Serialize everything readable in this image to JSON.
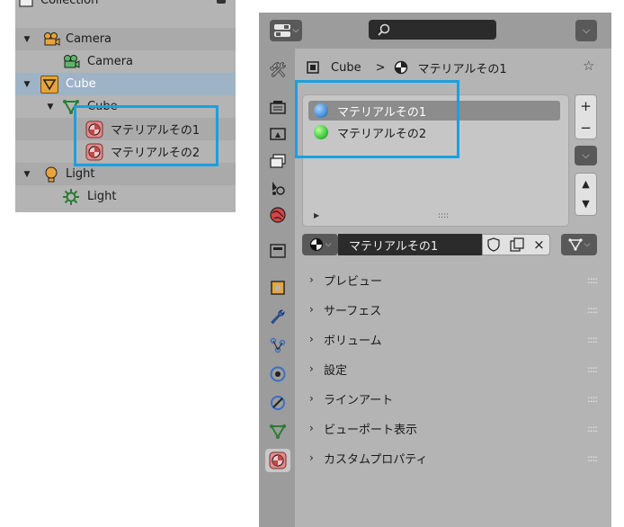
{
  "outliner": {
    "collection": "Collection",
    "camera_object": "Camera",
    "camera_data": "Camera",
    "cube_object": "Cube",
    "cube_mesh": "Cube",
    "material_1": "マテリアルその1",
    "material_2": "マテリアルその2",
    "light_object": "Light",
    "light_data": "Light"
  },
  "properties": {
    "breadcrumb": {
      "object": "Cube",
      "separator": ">",
      "material": "マテリアルその1"
    },
    "material_slots": [
      "マテリアルその1",
      "マテリアルその2"
    ],
    "material_slots_selected": 0,
    "list_buttons": {
      "add": "+",
      "remove": "−"
    },
    "list_grip": "::::",
    "datablock": {
      "name": "マテリアルその1",
      "unlink": "×"
    },
    "sections": [
      {
        "label": "プレビュー"
      },
      {
        "label": "サーフェス"
      },
      {
        "label": "ボリューム"
      },
      {
        "label": "設定"
      },
      {
        "label": "ラインアート"
      },
      {
        "label": "ビューポート表示"
      },
      {
        "label": "カスタムプロパティ"
      }
    ],
    "section_grip": "::::",
    "active_tab": "material"
  },
  "colors": {
    "highlight_box": "#1aa0e0",
    "material_1": "#4a90d9",
    "material_2": "#3ec93e",
    "selected_row": "#9eb3c5"
  }
}
